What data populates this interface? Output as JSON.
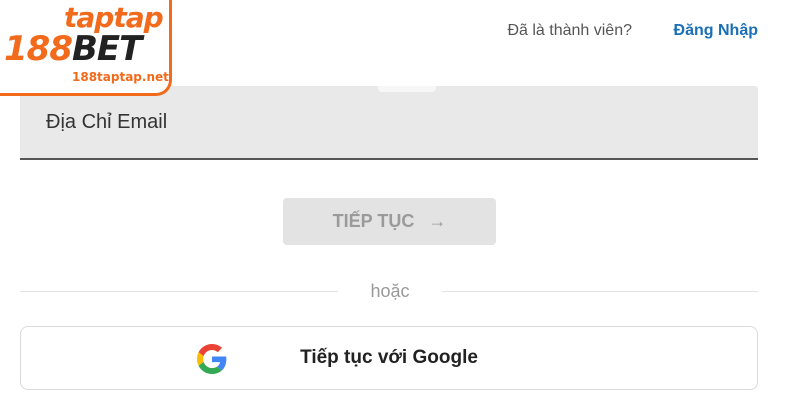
{
  "logo": {
    "top_text": "taptap",
    "main_number": "188",
    "main_word": "BET",
    "domain": "188taptap.net"
  },
  "header": {
    "member_prompt": "Đã là thành viên?",
    "login_link": "Đăng Nhập"
  },
  "form": {
    "email_placeholder": "Địa Chỉ Email",
    "continue_label": "TIẾP TỤC",
    "continue_arrow": "→",
    "divider_text": "hoặc",
    "google_label": "Tiếp tục với Google"
  },
  "colors": {
    "brand_orange": "#f26a1b",
    "link_blue": "#1a6fb6",
    "field_bg": "#e9e9e9",
    "button_disabled_bg": "#e3e3e3"
  },
  "icons": {
    "google": "google-logo-icon",
    "arrow": "arrow-right-icon"
  }
}
